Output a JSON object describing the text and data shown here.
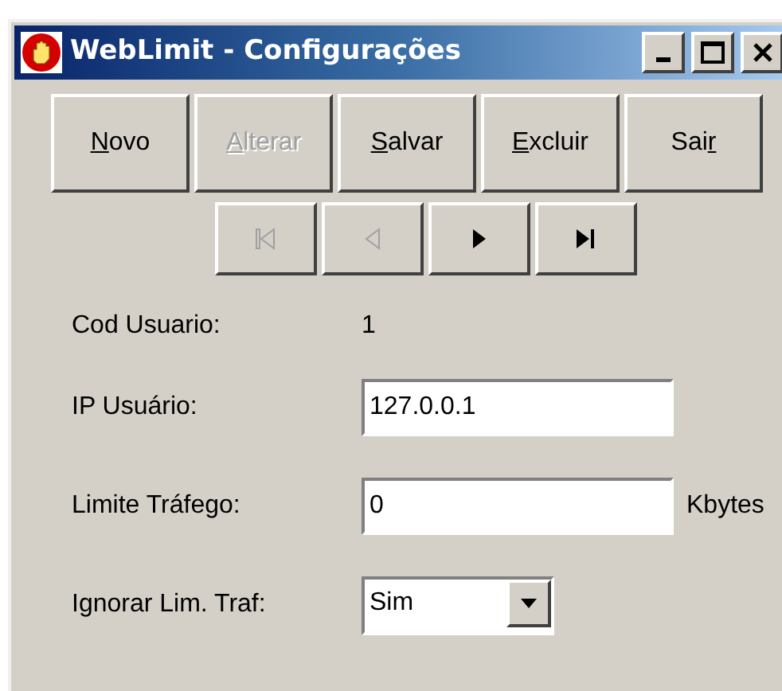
{
  "window": {
    "title": "WebLimit - Configurações"
  },
  "buttons": [
    {
      "key": "N",
      "post": "ovo",
      "disabled": false
    },
    {
      "key": "A",
      "post": "lterar",
      "disabled": true
    },
    {
      "key": "S",
      "post": "alvar",
      "disabled": false
    },
    {
      "key": "E",
      "post": "xcluir",
      "disabled": false
    },
    {
      "pre": "Sai",
      "key": "r",
      "disabled": false
    }
  ],
  "navigator": [
    {
      "kind": "first",
      "disabled": true
    },
    {
      "kind": "prior",
      "disabled": true
    },
    {
      "kind": "next",
      "disabled": false
    },
    {
      "kind": "last",
      "disabled": false
    }
  ],
  "fields": [
    {
      "kind": "display",
      "label": "Cod Usuario:",
      "value": "1"
    },
    {
      "kind": "text",
      "label": "IP Usuário:",
      "value": "127.0.0.1"
    },
    {
      "kind": "text",
      "label": "Limite Tráfego:",
      "value": "0",
      "unit": "Kbytes"
    },
    {
      "kind": "combo",
      "label": "Ignorar Lim. Traf:",
      "value": "Sim"
    }
  ]
}
